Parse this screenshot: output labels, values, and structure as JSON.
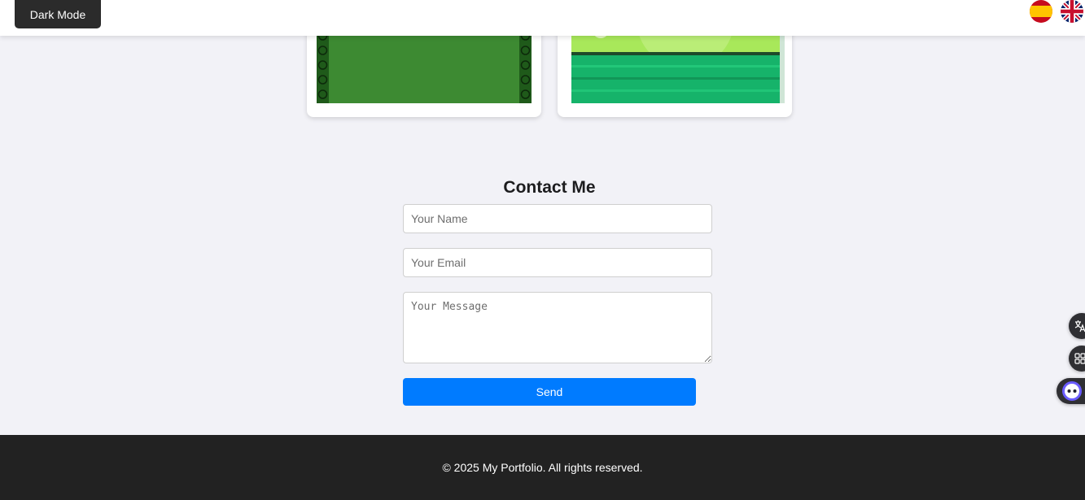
{
  "header": {
    "dark_mode_label": "Dark Mode",
    "languages": [
      {
        "code": "es",
        "icon": "spain-flag-icon"
      },
      {
        "code": "en",
        "icon": "uk-flag-icon"
      }
    ]
  },
  "contact": {
    "title": "Contact Me",
    "name_placeholder": "Your Name",
    "email_placeholder": "Your Email",
    "message_placeholder": "Your Message",
    "send_label": "Send"
  },
  "footer": {
    "text": "© 2025 My Portfolio. All rights reserved."
  },
  "side_tools": {
    "translate_icon": "translate-icon",
    "apps_icon": "apps-grid-icon",
    "assistant_icon": "assistant-bot-icon"
  },
  "colors": {
    "page_bg": "#f2f2f7",
    "accent": "#007bff",
    "footer_bg": "#222222",
    "dark_button_bg": "#2b2b2b"
  }
}
